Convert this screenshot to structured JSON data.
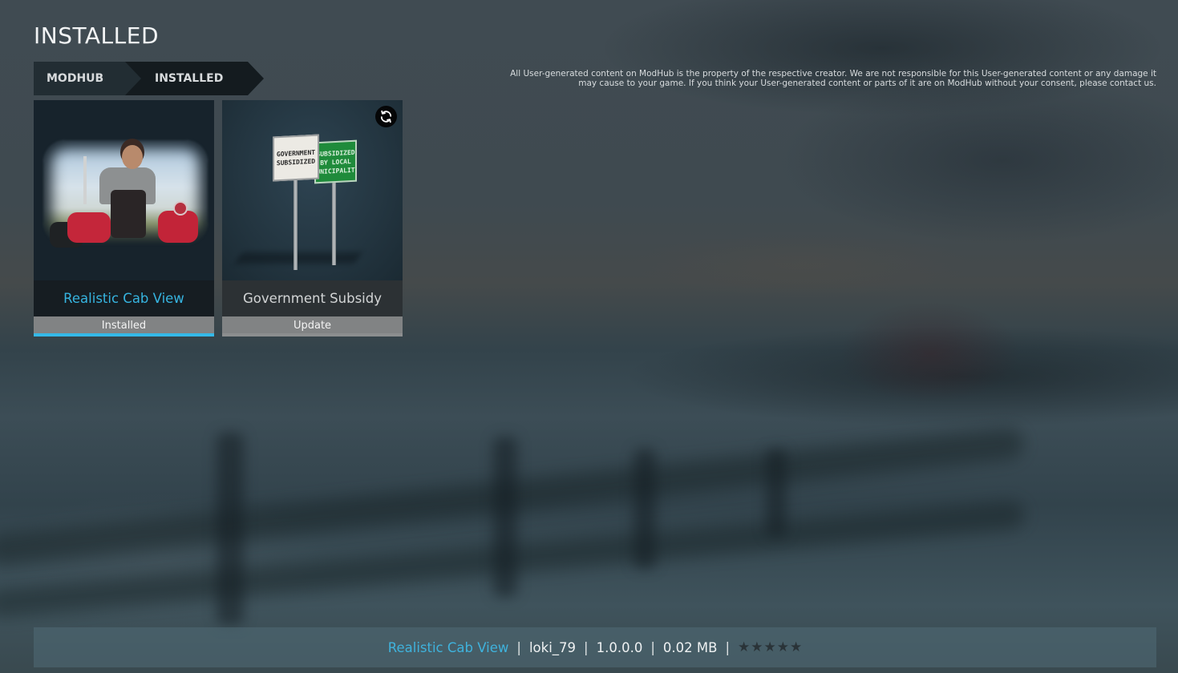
{
  "page": {
    "title": "INSTALLED"
  },
  "breadcrumb": [
    {
      "label": "MODHUB"
    },
    {
      "label": "INSTALLED"
    }
  ],
  "disclaimer": {
    "line1": "All User-generated content on ModHub is the property of the respective creator. We are not responsible for this User-generated content or any damage it",
    "line2": "may cause to your game. If you think your User-generated content or parts of it are on ModHub without your consent, please contact us."
  },
  "mods": [
    {
      "name": "Realistic Cab View",
      "status": "Installed",
      "selected": true,
      "has_update": false,
      "thumbnail": "farmer-on-red-tractor"
    },
    {
      "name": "Government Subsidy",
      "status": "Update",
      "selected": false,
      "has_update": true,
      "thumbnail": "road-signs",
      "sign_white_text": "GOVERNMENT SUBSIDIZED",
      "sign_green_text": "SUBSIDIZED BY LOCAL MUNICIPALITY"
    }
  ],
  "info_bar": {
    "name": "Realistic Cab View",
    "author": "loki_79",
    "version": "1.0.0.0",
    "size": "0.02 MB",
    "separator": "|",
    "rating": 0,
    "rating_max": 5,
    "star_glyph": "★"
  },
  "colors": {
    "accent": "#34b9e8",
    "status_bar": "#818384",
    "selected_name_bg": "#161d22"
  },
  "icons": {
    "update": "refresh-icon"
  }
}
